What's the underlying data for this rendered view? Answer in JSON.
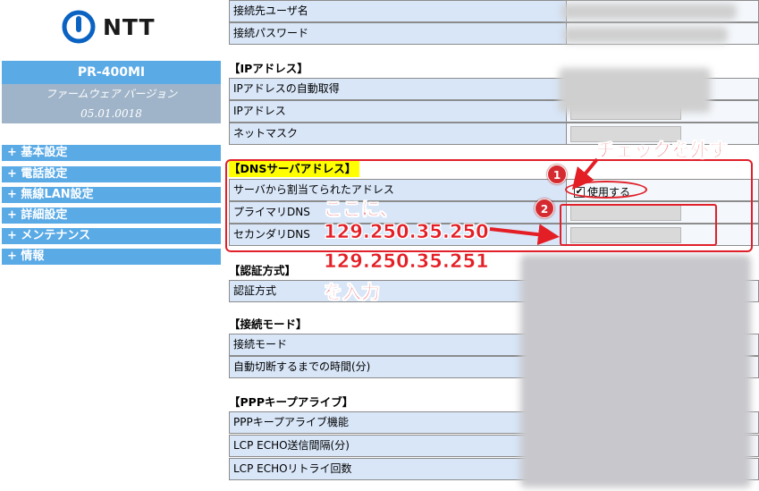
{
  "brand": {
    "logo_text": "NTT"
  },
  "device": {
    "model": "PR-400MI",
    "fw_label": "ファームウェア バージョン",
    "fw_version": "05.01.0018"
  },
  "menu": [
    "+ 基本設定",
    "+ 電話設定",
    "+ 無線LAN設定",
    "+ 詳細設定",
    "+ メンテナンス",
    "+ 情報"
  ],
  "top_rows": [
    "接続先ユーザ名",
    "接続パスワード"
  ],
  "sections": {
    "ip": {
      "title": "【IPアドレス】",
      "rows": [
        "IPアドレスの自動取得",
        "IPアドレス",
        "ネットマスク"
      ]
    },
    "dns": {
      "title": "【DNSサーバアドレス】",
      "rows": [
        "サーバから割当てられたアドレス",
        "プライマリDNS",
        "セカンダリDNS"
      ],
      "checkbox_label": "使用する",
      "checkbox_checked": true
    },
    "auth": {
      "title": "【認証方式】",
      "rows": [
        "認証方式"
      ]
    },
    "mode": {
      "title": "【接続モード】",
      "rows": [
        "接続モード",
        "自動切断するまでの時間(分)"
      ]
    },
    "ppp": {
      "title": "【PPPキープアライブ】",
      "rows": [
        "PPPキープアライブ機能",
        "LCP ECHO送信間隔(分)",
        "LCP ECHOリトライ回数"
      ]
    }
  },
  "annotations": {
    "badge1": "1",
    "badge2": "2",
    "uncheck": "チェックを外す",
    "here": "ここに、",
    "dns1": "129.250.35.250",
    "dns2": "129.250.35.251",
    "enter": "を入力"
  },
  "colors": {
    "menu_blue": "#5aaae6",
    "label_bg": "#d8e6f8",
    "annotation_red": "#e41e25",
    "highlight": "#ffff00"
  }
}
